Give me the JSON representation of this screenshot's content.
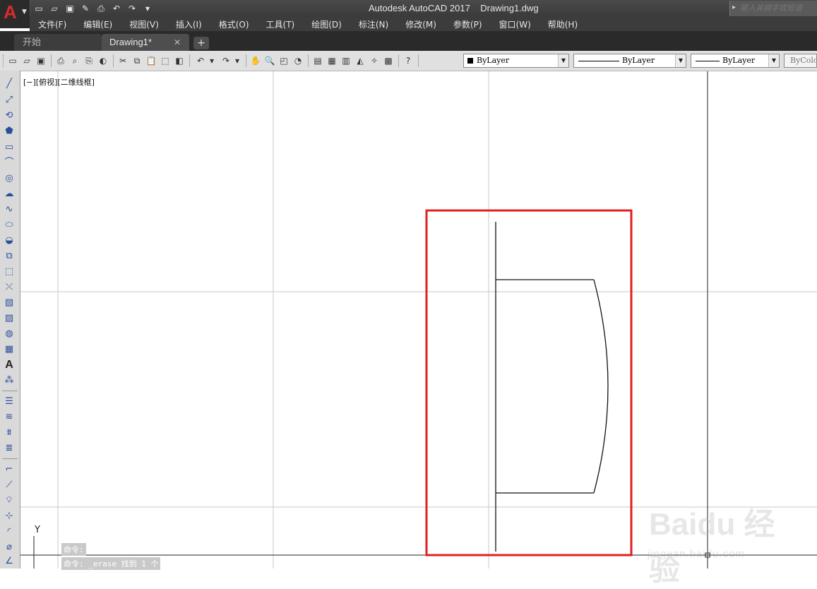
{
  "title_bar": {
    "app_title": "Autodesk AutoCAD 2017",
    "file_name": "Drawing1.dwg",
    "search_placeholder": "键入关键字或短语",
    "app_button_letter": "A"
  },
  "quick_access": [
    "new-icon",
    "open-icon",
    "save-icon",
    "save-as-icon",
    "plot-icon",
    "undo-icon",
    "redo-icon",
    "customize-icon"
  ],
  "menu": [
    {
      "label": "文件(F)"
    },
    {
      "label": "编辑(E)"
    },
    {
      "label": "视图(V)"
    },
    {
      "label": "插入(I)"
    },
    {
      "label": "格式(O)"
    },
    {
      "label": "工具(T)"
    },
    {
      "label": "绘图(D)"
    },
    {
      "label": "标注(N)"
    },
    {
      "label": "修改(M)"
    },
    {
      "label": "参数(P)"
    },
    {
      "label": "窗口(W)"
    },
    {
      "label": "帮助(H)"
    }
  ],
  "tabs": {
    "start": "开始",
    "drawing": "Drawing1*",
    "add": "+"
  },
  "properties": {
    "color": "ByLayer",
    "linetype": "ByLayer",
    "lineweight": "ByLayer",
    "plotstyle": "ByColor"
  },
  "viewport": {
    "label": "[−][俯视][二维线框]",
    "ucs_y": "Y"
  },
  "command": {
    "line1": "命令:",
    "line2": "命令: _erase 找到 1 个"
  },
  "watermark": {
    "brand": "Baidu 经验",
    "url": "jingyan.baidu.com"
  },
  "colors": {
    "highlight_box": "#e02020",
    "title_bar": "#3f3f3f",
    "canvas": "#ffffff"
  }
}
